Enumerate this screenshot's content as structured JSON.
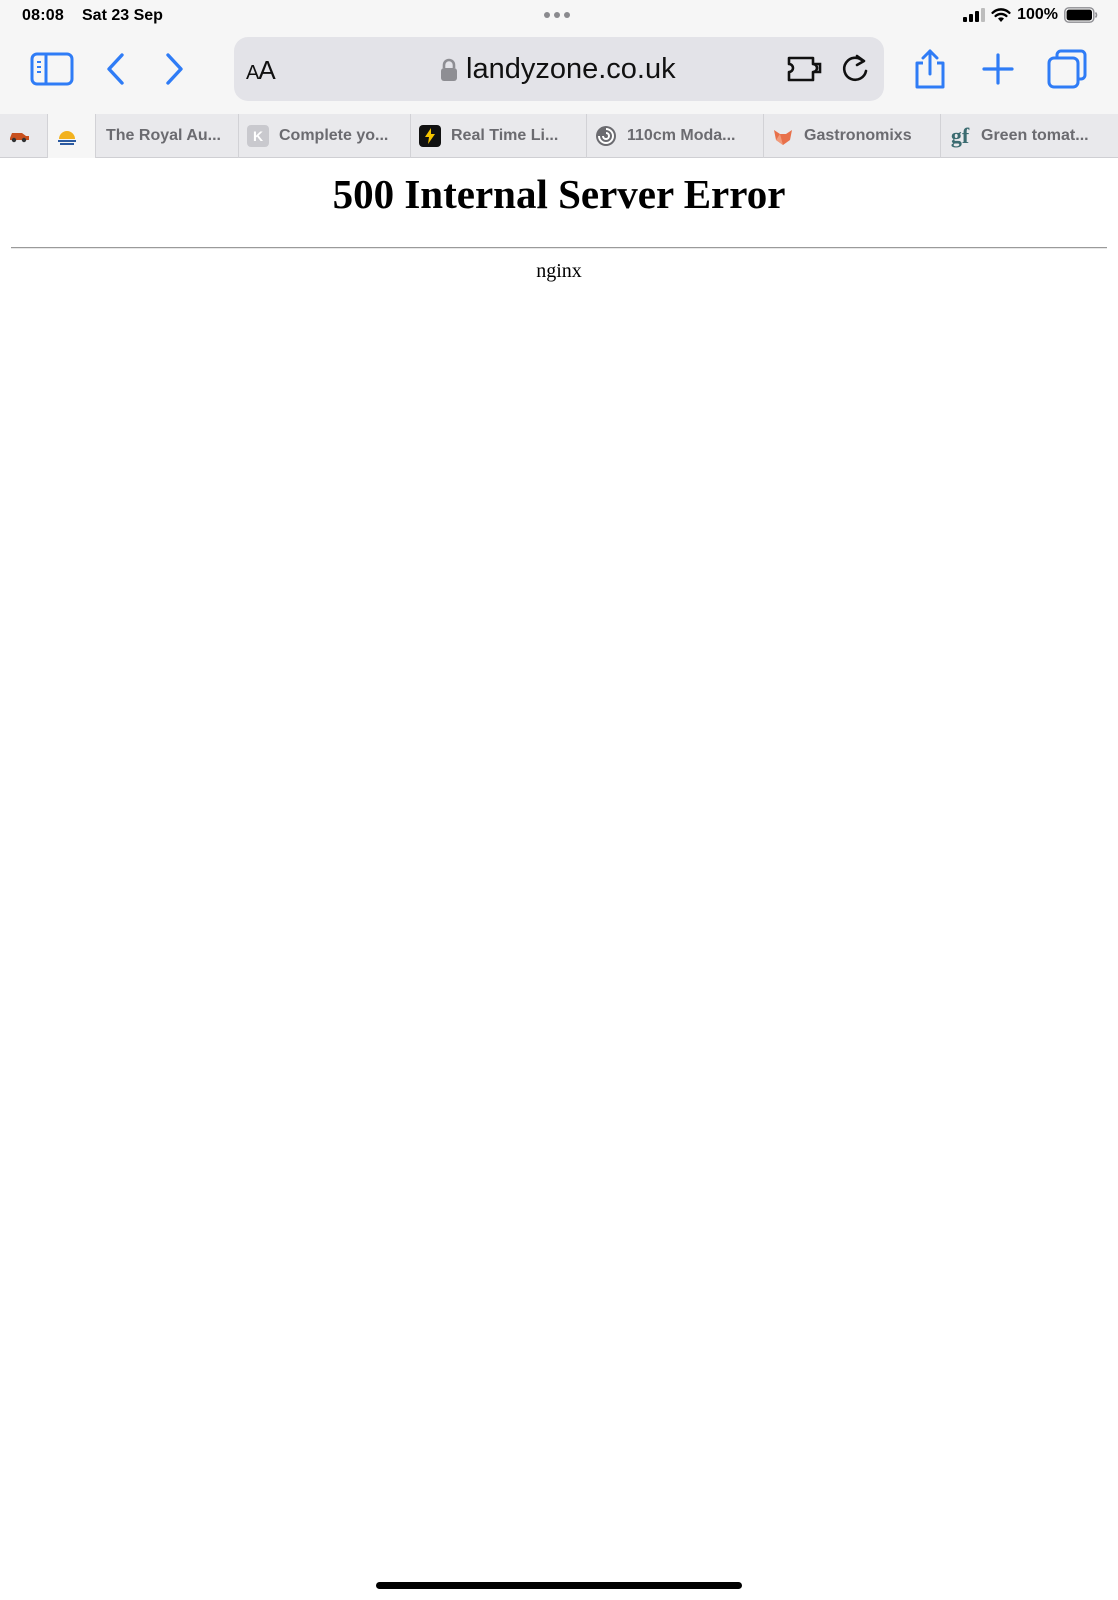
{
  "status_bar": {
    "time": "08:08",
    "date": "Sat 23 Sep",
    "battery": "100%"
  },
  "toolbar": {
    "aa_label_small": "A",
    "aa_label_large": "A",
    "url": "landyzone.co.uk",
    "accent_color": "#2f7cf6"
  },
  "tabs": [
    {
      "title": "",
      "icon": "car-favicon"
    },
    {
      "title": "",
      "icon": "sunrise-favicon"
    },
    {
      "title": "The Royal Au...",
      "icon": ""
    },
    {
      "title": "Complete yo...",
      "icon": "k-favicon",
      "icon_text": "K"
    },
    {
      "title": "Real Time Li...",
      "icon": "lightning-favicon"
    },
    {
      "title": "110cm Moda...",
      "icon": "swirl-favicon"
    },
    {
      "title": "Gastronomixs",
      "icon": "fox-favicon"
    },
    {
      "title": "Green tomat...",
      "icon": "gf-favicon",
      "icon_text": "gf"
    }
  ],
  "page": {
    "title": "500 Internal Server Error",
    "server": "nginx"
  }
}
